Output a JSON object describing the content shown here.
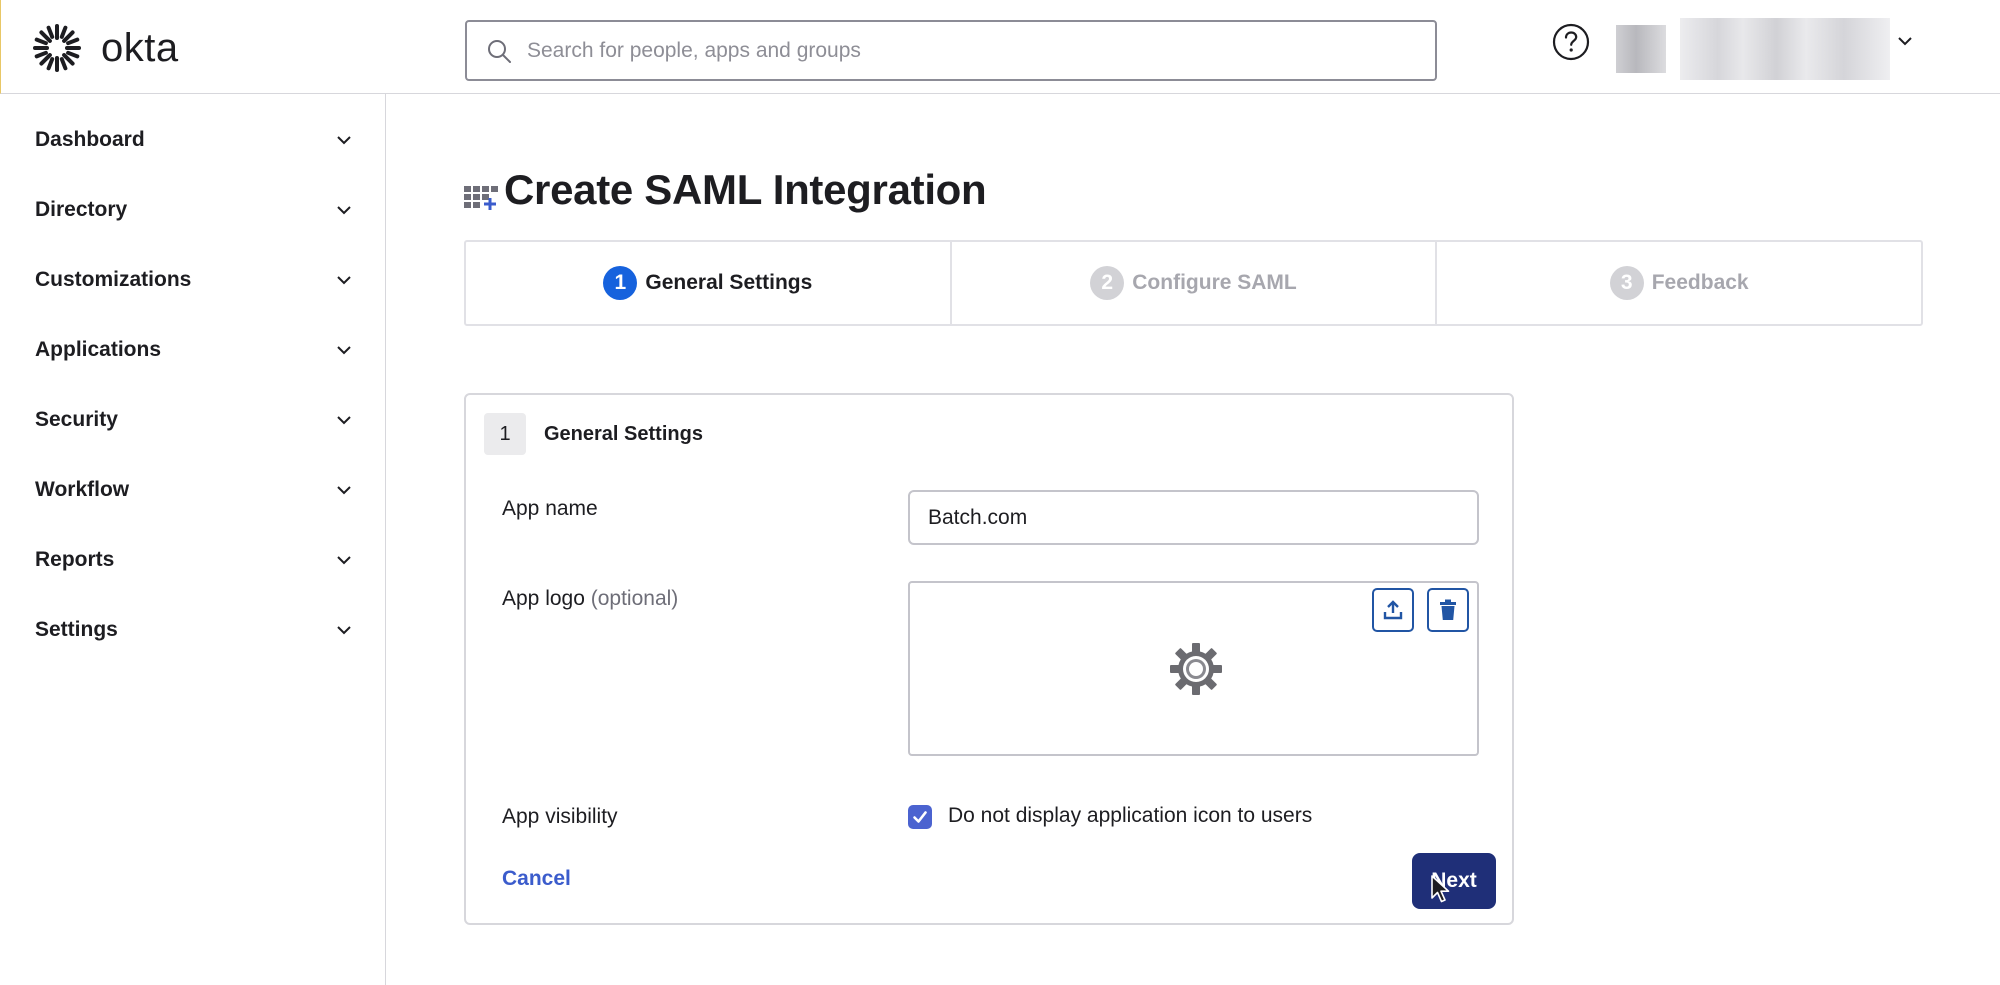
{
  "header": {
    "brand": "okta",
    "search_placeholder": "Search for people, apps and groups",
    "icons": [
      "okta-sunburst-logo",
      "search-icon",
      "help-icon",
      "chevron-down-icon"
    ]
  },
  "sidebar": {
    "items": [
      {
        "label": "Dashboard"
      },
      {
        "label": "Directory"
      },
      {
        "label": "Customizations"
      },
      {
        "label": "Applications"
      },
      {
        "label": "Security"
      },
      {
        "label": "Workflow"
      },
      {
        "label": "Reports"
      },
      {
        "label": "Settings"
      }
    ]
  },
  "page": {
    "title": "Create SAML Integration"
  },
  "stepper": {
    "steps": [
      {
        "num": "1",
        "label": "General Settings",
        "state": "active"
      },
      {
        "num": "2",
        "label": "Configure SAML",
        "state": "inactive"
      },
      {
        "num": "3",
        "label": "Feedback",
        "state": "inactive"
      }
    ]
  },
  "form": {
    "section_num": "1",
    "section_title": "General Settings",
    "app_name_label": "App name",
    "app_name_value": "Batch.com",
    "app_logo_label": "App logo",
    "app_logo_optional": "(optional)",
    "app_visibility_label": "App visibility",
    "visibility_checkbox_label": "Do not display application icon to users",
    "visibility_checked": true,
    "cancel_label": "Cancel",
    "next_label": "Next"
  },
  "colors": {
    "active_step": "#1662dd",
    "next_button": "#1f2f78",
    "link": "#3b5ccc",
    "checkbox": "#4b63d0"
  }
}
